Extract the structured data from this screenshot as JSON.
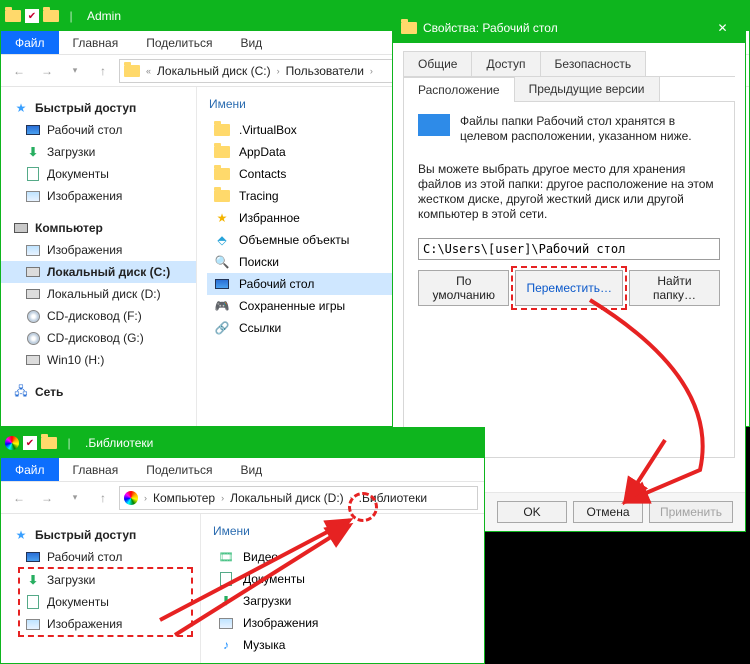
{
  "win1": {
    "title": "Admin",
    "ribbon": {
      "file": "Файл",
      "tabs": [
        "Главная",
        "Поделиться",
        "Вид"
      ]
    },
    "breadcrumbs": [
      "Локальный диск (C:)",
      "Пользователи"
    ],
    "nav": {
      "quick_head": "Быстрый доступ",
      "quick": [
        {
          "label": "Рабочий стол",
          "icon": "desktop"
        },
        {
          "label": "Загрузки",
          "icon": "down"
        },
        {
          "label": "Документы",
          "icon": "doc"
        },
        {
          "label": "Изображения",
          "icon": "pic"
        }
      ],
      "pc_head": "Компьютер",
      "pc": [
        {
          "label": "Изображения",
          "icon": "pic"
        },
        {
          "label": "Локальный диск (C:)",
          "icon": "disk",
          "sel": true
        },
        {
          "label": "Локальный диск (D:)",
          "icon": "disk"
        },
        {
          "label": "CD-дисковод (F:)",
          "icon": "cd"
        },
        {
          "label": "CD-дисковод (G:)",
          "icon": "cd"
        },
        {
          "label": "Win10 (H:)",
          "icon": "disk"
        }
      ],
      "net_head": "Сеть"
    },
    "content_header": "Имени",
    "content_items": [
      {
        "label": ".VirtualBox"
      },
      {
        "label": "AppData"
      },
      {
        "label": "Contacts"
      },
      {
        "label": "Tracing"
      },
      {
        "label": "Избранное",
        "icon": "fav"
      },
      {
        "label": "Объемные объекты",
        "icon": "3d"
      },
      {
        "label": "Поиски",
        "icon": "search"
      },
      {
        "label": "Рабочий стол",
        "icon": "desktop",
        "sel": true
      },
      {
        "label": "Сохраненные игры",
        "icon": "game"
      },
      {
        "label": "Ссылки",
        "icon": "link"
      }
    ]
  },
  "dlg": {
    "title": "Свойства: Рабочий стол",
    "tabs_top": [
      "Общие",
      "Доступ",
      "Безопасность"
    ],
    "tabs_bot": [
      "Расположение",
      "Предыдущие версии"
    ],
    "active_tab": "Расположение",
    "note": "Файлы папки Рабочий стол хранятся в целевом расположении, указанном ниже.",
    "para": "Вы можете выбрать другое место для хранения файлов из этой папки: другое расположение на этом жестком диске, другой жесткий диск или другой компьютер в этой сети.",
    "path": "C:\\Users\\[user]\\Рабочий стол",
    "btn_default": "По умолчанию",
    "btn_move": "Переместить…",
    "btn_find": "Найти папку…",
    "ok": "OK",
    "cancel": "Отмена",
    "apply": "Применить"
  },
  "win2": {
    "title": ".Библиотеки",
    "ribbon": {
      "file": "Файл",
      "tabs": [
        "Главная",
        "Поделиться",
        "Вид"
      ]
    },
    "breadcrumbs": [
      "Компьютер",
      "Локальный диск (D:)",
      ".Библиотеки"
    ],
    "content_header": "Имени",
    "nav": {
      "quick_head": "Быстрый доступ",
      "quick": [
        {
          "label": "Рабочий стол",
          "icon": "desktop"
        },
        {
          "label": "Загрузки",
          "icon": "down"
        },
        {
          "label": "Документы",
          "icon": "doc"
        },
        {
          "label": "Изображения",
          "icon": "pic"
        }
      ]
    },
    "content_items": [
      {
        "label": "Видео",
        "icon": "video"
      },
      {
        "label": "Документы",
        "icon": "doc"
      },
      {
        "label": "Загрузки",
        "icon": "down"
      },
      {
        "label": "Изображения",
        "icon": "pic"
      },
      {
        "label": "Музыка",
        "icon": "music"
      }
    ]
  }
}
